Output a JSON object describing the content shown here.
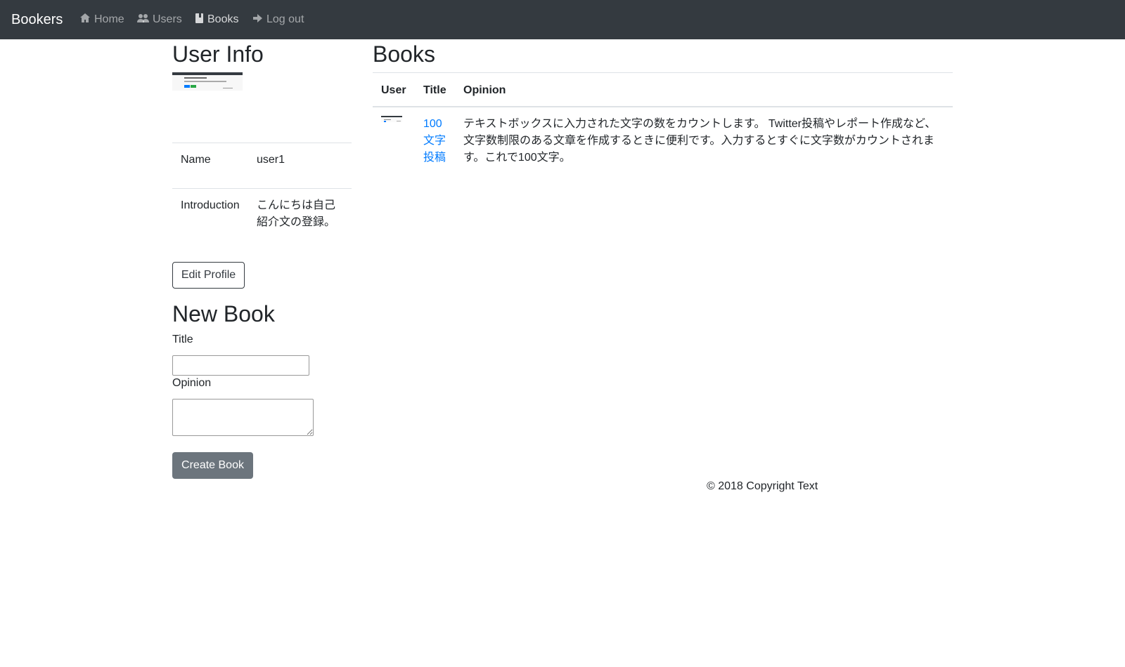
{
  "navbar": {
    "brand": "Bookers",
    "links": [
      {
        "label": "Home",
        "icon": "home-icon"
      },
      {
        "label": "Users",
        "icon": "users-icon"
      },
      {
        "label": "Books",
        "icon": "book-icon",
        "active": true
      },
      {
        "label": "Log out",
        "icon": "logout-arrow-icon"
      }
    ]
  },
  "user_info": {
    "heading": "User Info",
    "rows": [
      {
        "label": "Name",
        "value": "user1"
      },
      {
        "label": "Introduction",
        "value": "こんにちは自己紹介文の登録。"
      }
    ],
    "edit_button": "Edit Profile"
  },
  "new_book": {
    "heading": "New Book",
    "title_label": "Title",
    "title_value": "",
    "opinion_label": "Opinion",
    "opinion_value": "",
    "submit_button": "Create Book"
  },
  "books": {
    "heading": "Books",
    "columns": [
      "User",
      "Title",
      "Opinion"
    ],
    "rows": [
      {
        "title": "100文字投稿",
        "opinion": "テキストボックスに入力された文字の数をカウントします。 Twitter投稿やレポート作成など、文字数制限のある文章を作成するときに便利です。入力するとすぐに文字数がカウントされます。これで100文字。"
      }
    ]
  },
  "footer": {
    "text": "© 2018 Copyright Text"
  },
  "colors": {
    "navbar_bg": "#343a40",
    "link": "#007bff",
    "secondary_button": "#6c757d",
    "border": "#dee2e6"
  }
}
